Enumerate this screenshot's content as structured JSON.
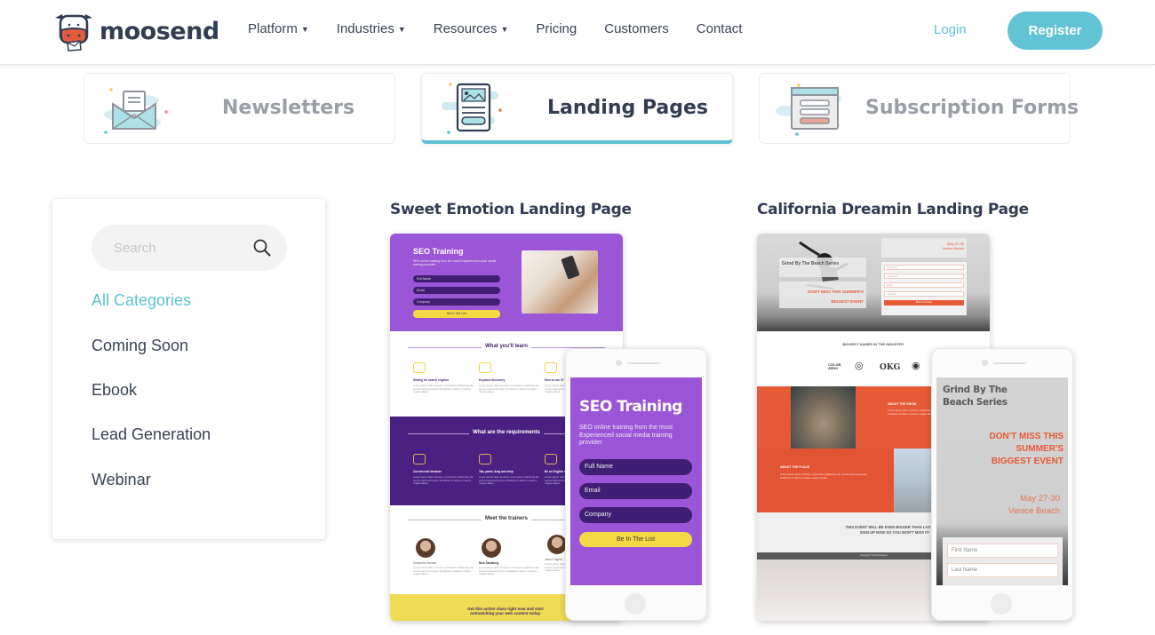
{
  "header": {
    "logo_text": "moosend",
    "nav": [
      {
        "label": "Platform",
        "has_caret": true
      },
      {
        "label": "Industries",
        "has_caret": true
      },
      {
        "label": "Resources",
        "has_caret": true
      },
      {
        "label": "Pricing",
        "has_caret": false
      },
      {
        "label": "Customers",
        "has_caret": false
      },
      {
        "label": "Contact",
        "has_caret": false
      }
    ],
    "caret_glyph": "▼",
    "login_label": "Login",
    "register_label": "Register"
  },
  "type_tabs": [
    {
      "label": "Newsletters",
      "icon": "envelope-icon",
      "active": false
    },
    {
      "label": "Landing Pages",
      "icon": "landing-page-icon",
      "active": true
    },
    {
      "label": "Subscription Forms",
      "icon": "form-icon",
      "active": false
    }
  ],
  "sidebar": {
    "search_placeholder": "Search",
    "search_value": "",
    "categories": [
      {
        "label": "All Categories",
        "active": true
      },
      {
        "label": "Coming Soon",
        "active": false
      },
      {
        "label": "Ebook",
        "active": false
      },
      {
        "label": "Lead Generation",
        "active": false
      },
      {
        "label": "Webinar",
        "active": false
      }
    ]
  },
  "templates": [
    {
      "title": "Sweet Emotion Landing Page",
      "desktop": {
        "hero_title": "SEO Training",
        "hero_sub": "SEO online training from the most Experienced social media training provider",
        "fields": [
          "Full Name",
          "Email",
          "Company"
        ],
        "button": "Be In The List",
        "section1": "What you'll learn",
        "features1": [
          "Writing for search engines",
          "Keyword discovery",
          "How to use it?"
        ],
        "section2": "What are the requirements",
        "features2": [
          "Current web browser",
          "Tab, paste, drag and drop",
          "Be an English speaker"
        ],
        "section3": "Meet the trainers",
        "trainers": [
          "Samantha Stewart",
          "Nick Sandberg",
          "Jason Hughes"
        ],
        "lorem": "Lorem ipsum dolor sit amet, consectetur adipiscing elit, sed do eiusmod tempor incididunt ut labore et dolore magna aliqua.",
        "footer_text": "Get this action class right now and start outmatching your web content today."
      },
      "mobile": {
        "title": "SEO Training",
        "subtitle": "SEO online training from the most Experienced social media training provider.",
        "fields": [
          "Full Name",
          "Email",
          "Company"
        ],
        "button": "Be In The List"
      }
    },
    {
      "title": "California Dreamin Landing Page",
      "desktop": {
        "series": "Grind By The Beach Series",
        "headline_1": "DON'T MISS THIS SUMMER'S",
        "headline_2": "BIGGEST EVENT",
        "dates": "May 27-30",
        "location": "Venice Beach",
        "fields": [
          "First Name",
          "Last Name",
          "Email",
          "Company"
        ],
        "button": "Book Your Place",
        "names_title": "BIGGEST NAMES IN THE INDUSTRY",
        "brands": [
          "COLOR ZERO",
          "◎",
          "OKG",
          "◉"
        ],
        "about_show": "ABOUT THE SHOW",
        "about_place": "ABOUT THE PLACE",
        "lorem": "Lorem ipsum dolor sit amet, consectetur adipiscing elit, sed do eiusmod tempor incididunt ut labore et dolore magna aliqua.",
        "event_line_1": "THIS EVENT WILL BE EVEN BIGGER THAN LAST YEAR",
        "event_line_2": "SIGN UP NOW SO YOU WON'T MISS IT!",
        "copyright": "Copyright © 2019 Moosend"
      },
      "mobile": {
        "series_1": "Grind By The",
        "series_2": "Beach Series",
        "headline_1": "DON'T MISS THIS",
        "headline_2": "SUMMER'S",
        "headline_3": "BIGGEST EVENT",
        "dates": "May 27-30",
        "location": "Venice Beach",
        "fields": [
          "First Name",
          "Last Name"
        ]
      }
    }
  ],
  "colors": {
    "accent": "#5ec1d2",
    "text_dark": "#323d52",
    "sweet_purple": "#9b55d7",
    "sweet_dark_purple": "#4a2082",
    "sweet_yellow": "#f5d846",
    "california_orange": "#e65a36"
  }
}
